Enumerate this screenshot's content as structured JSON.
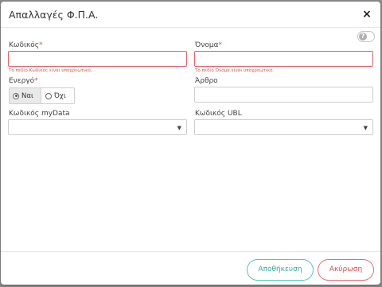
{
  "dialog": {
    "title": "Απαλλαγές Φ.Π.Α.",
    "close_label": "×",
    "help_label": "?"
  },
  "form": {
    "code": {
      "label": "Κωδικός",
      "required_mark": "*",
      "value": "",
      "error": "Το πεδίο Κωδικός είναι υποχρεωτικό."
    },
    "name": {
      "label": "Όνομα",
      "required_mark": "*",
      "value": "",
      "error": "Το πεδίο Όνομα είναι υποχρεωτικό."
    },
    "active": {
      "label": "Ενεργό",
      "required_mark": "*",
      "options": [
        {
          "label": "Ναι",
          "selected": true
        },
        {
          "label": "Όχι",
          "selected": false
        }
      ]
    },
    "article": {
      "label": "Άρθρο",
      "value": ""
    },
    "mydata_code": {
      "label": "Κωδικός myData",
      "selected": ""
    },
    "ubl_code": {
      "label": "Κωδικός UBL",
      "selected": ""
    }
  },
  "footer": {
    "save_label": "Αποθήκευση",
    "cancel_label": "Ακύρωση"
  },
  "colors": {
    "save_accent": "#4fc7b0",
    "cancel_accent": "#e26b72",
    "error": "#e0523f"
  },
  "icons": [
    "close-icon",
    "help-icon",
    "chevron-down-icon"
  ]
}
